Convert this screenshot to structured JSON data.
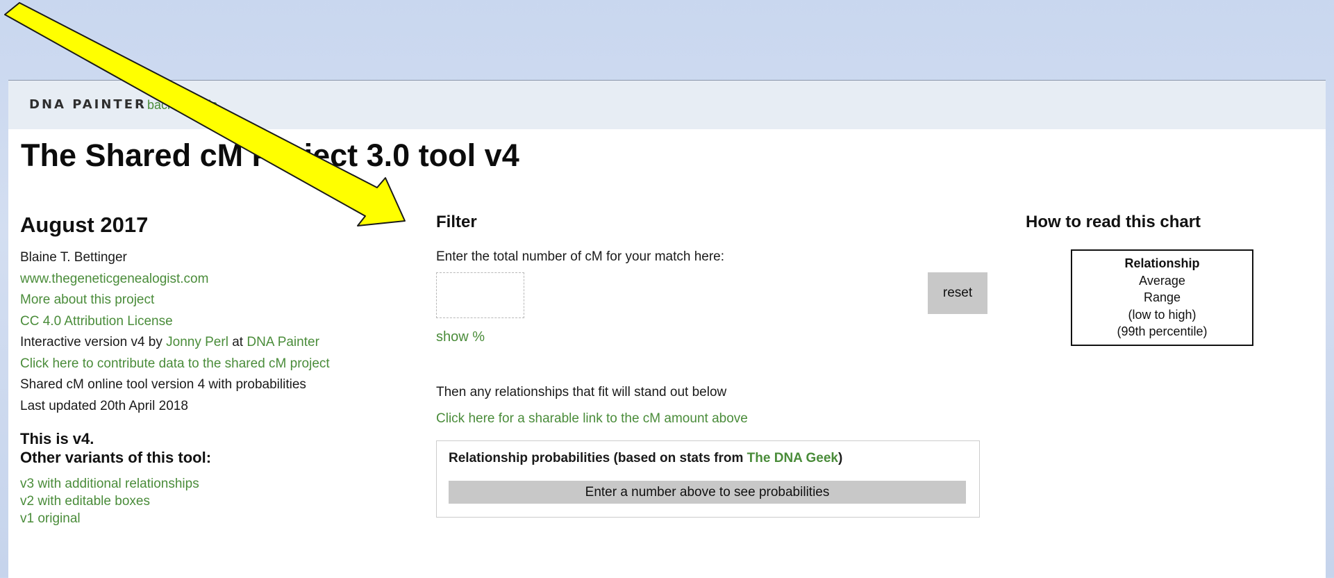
{
  "navbar": {
    "brand": "DNA PAINTER",
    "back_link": "back to tools"
  },
  "page_title": "The Shared cM Project 3.0 tool v4",
  "left": {
    "heading": "August 2017",
    "author": "Blaine T. Bettinger",
    "website": "www.thegeneticgenealogist.com",
    "more_about": "More about this project",
    "license": "CC 4.0 Attribution License",
    "interactive_prefix": "Interactive version v4 by ",
    "interactive_author": "Jonny Perl",
    "interactive_at": " at ",
    "interactive_site": "DNA Painter",
    "contribute": "Click here to contribute data to the shared cM project",
    "tool_version": "Shared cM online tool version 4 with probabilities",
    "last_updated": "Last updated 20th April 2018",
    "variants_heading_1": "This is v4.",
    "variants_heading_2": "Other variants of this tool:",
    "variants": [
      "v3 with additional relationships",
      "v2 with editable boxes",
      "v1 original"
    ]
  },
  "filter": {
    "heading": "Filter",
    "hint": "Enter the total number of cM for your match here:",
    "input_value": "",
    "reset_label": "reset",
    "show_percent": "show %",
    "then_text": "Then any relationships that fit will stand out below",
    "share_link": "Click here for a sharable link to the cM amount above",
    "prob_title_prefix": "Relationship probabilities (based on stats from ",
    "prob_title_link": "The DNA Geek",
    "prob_title_suffix": ")",
    "prob_placeholder": "Enter a number above to see probabilities"
  },
  "legend": {
    "heading": "How to read this chart",
    "lines": [
      "Relationship",
      "Average",
      "Range",
      "(low to high)",
      "(99th percentile)"
    ]
  },
  "colors": {
    "link_green": "#4a8c3a",
    "arrow_yellow": "#ffff00",
    "background_blue": "#c9d7ef"
  }
}
